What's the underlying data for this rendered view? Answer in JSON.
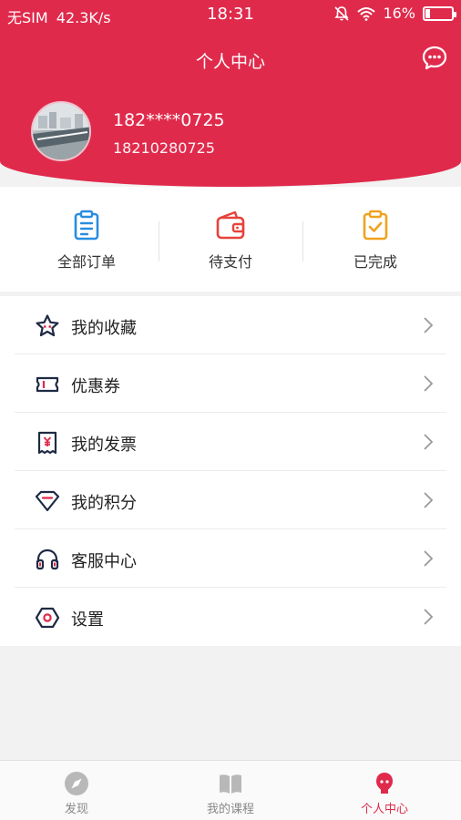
{
  "status_bar": {
    "carrier": "无SIM",
    "speed": "42.3K/s",
    "time": "18:31",
    "battery": "16%"
  },
  "header": {
    "title": "个人中心",
    "message_icon": "chat-bubble-icon"
  },
  "profile": {
    "phone_masked": "182****0725",
    "phone_full": "18210280725"
  },
  "orders": [
    {
      "label": "全部订单",
      "icon": "clipboard-icon",
      "color": "#2a8de0"
    },
    {
      "label": "待支付",
      "icon": "wallet-icon",
      "color": "#e6423c"
    },
    {
      "label": "已完成",
      "icon": "clipboard-check-icon",
      "color": "#f0a21f"
    }
  ],
  "menu": [
    {
      "label": "我的收藏",
      "icon": "star-icon"
    },
    {
      "label": "优惠券",
      "icon": "coupon-icon"
    },
    {
      "label": "我的发票",
      "icon": "invoice-icon"
    },
    {
      "label": "我的积分",
      "icon": "diamond-icon"
    },
    {
      "label": "客服中心",
      "icon": "headphones-icon"
    },
    {
      "label": "设置",
      "icon": "settings-icon"
    }
  ],
  "bottom_nav": [
    {
      "label": "发现",
      "icon": "compass-icon",
      "active": false
    },
    {
      "label": "我的课程",
      "icon": "book-icon",
      "active": false
    },
    {
      "label": "个人中心",
      "icon": "user-icon",
      "active": true
    }
  ],
  "colors": {
    "brand_red": "#e02a4c",
    "icon_dark": "#1e2a44",
    "accent_red": "#e02a4c"
  }
}
